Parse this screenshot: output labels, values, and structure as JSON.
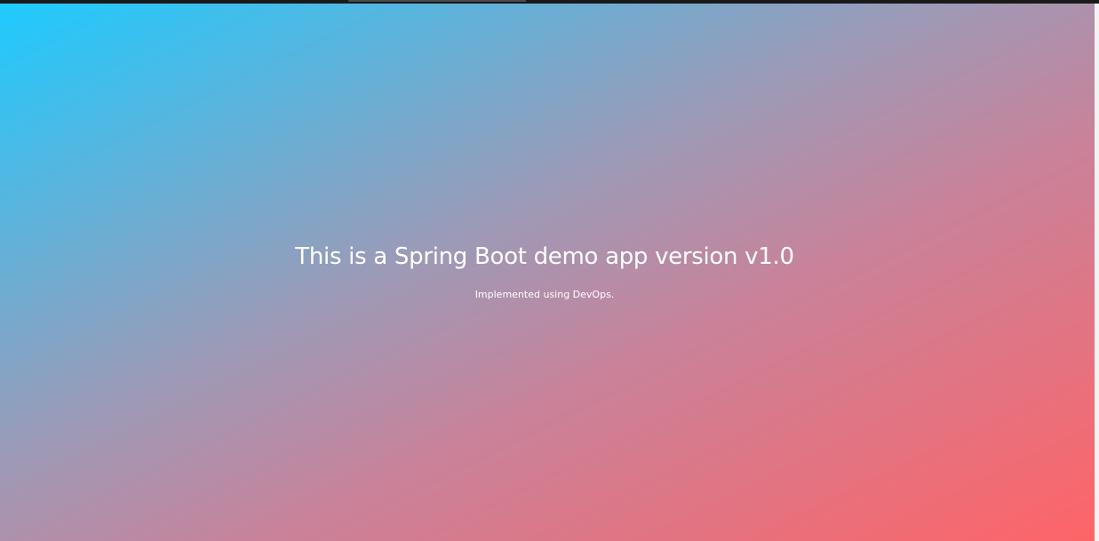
{
  "hero": {
    "title": "This is a Spring Boot demo app version v1.0",
    "subtitle": "Implemented using DevOps."
  },
  "colors": {
    "gradient_start": "#1ecbff",
    "gradient_mid": "#9b9bb8",
    "gradient_end": "#fe6467",
    "text": "#ffffff"
  }
}
